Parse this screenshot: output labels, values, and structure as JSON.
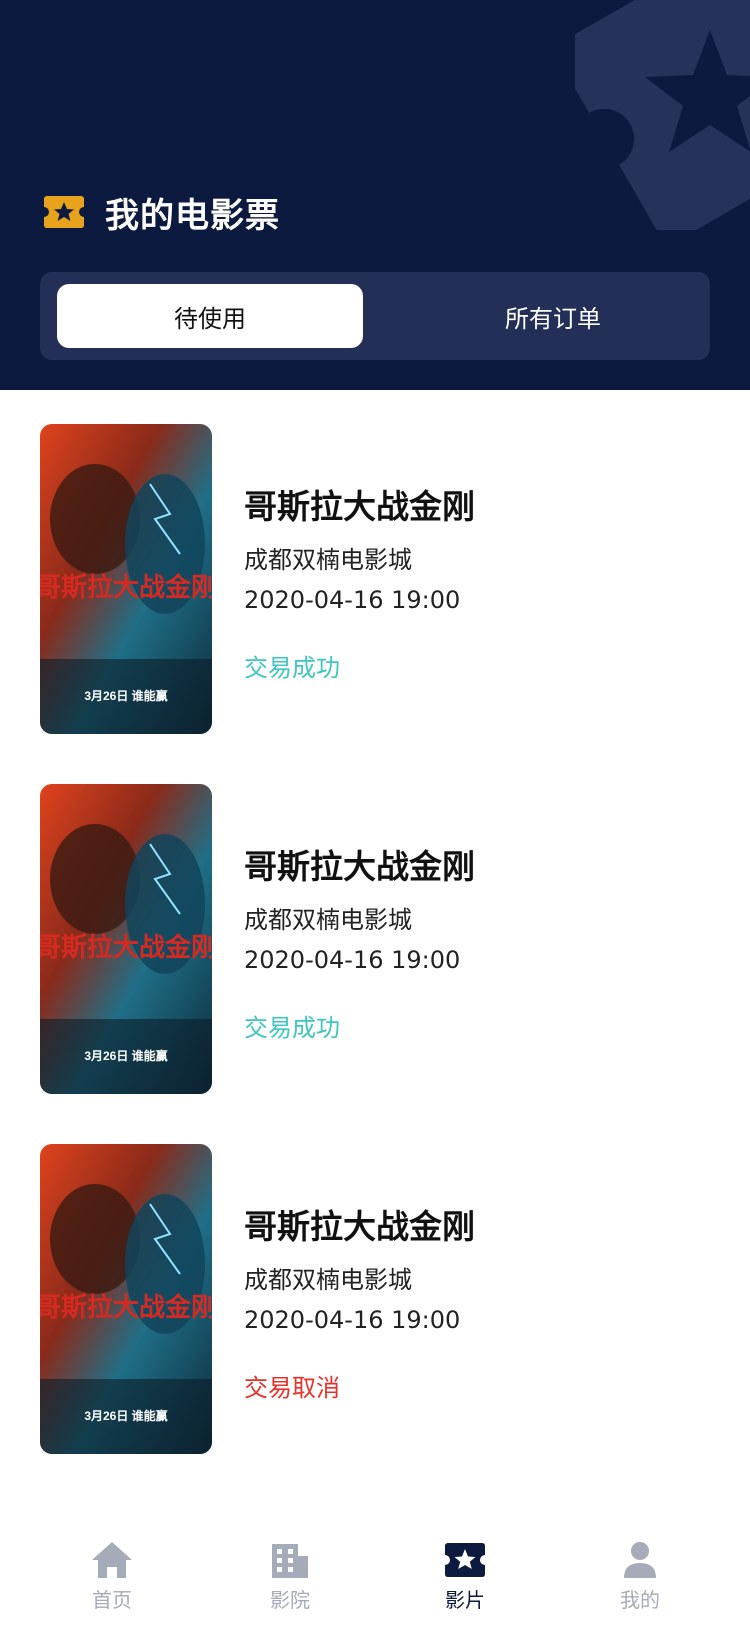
{
  "header": {
    "title": "我的电影票",
    "title_icon": "ticket-star-icon",
    "background_color": "#0d1a3f"
  },
  "tabs": [
    {
      "label": "待使用",
      "active": true
    },
    {
      "label": "所有订单",
      "active": false
    }
  ],
  "orders": [
    {
      "poster": {
        "top_text": "哥斯拉大战金刚",
        "bottom_text": "3月26日 谁能赢"
      },
      "movie_title": "哥斯拉大战金刚",
      "cinema": "成都双楠电影城",
      "datetime": "2020-04-16 19:00",
      "status": "交易成功",
      "status_color": "#3ec6c0"
    },
    {
      "poster": {
        "top_text": "哥斯拉大战金刚",
        "bottom_text": "3月26日 谁能赢"
      },
      "movie_title": "哥斯拉大战金刚",
      "cinema": "成都双楠电影城",
      "datetime": "2020-04-16 19:00",
      "status": "交易成功",
      "status_color": "#3ec6c0"
    },
    {
      "poster": {
        "top_text": "哥斯拉大战金刚",
        "bottom_text": "3月26日 谁能赢"
      },
      "movie_title": "哥斯拉大战金刚",
      "cinema": "成都双楠电影城",
      "datetime": "2020-04-16 19:00",
      "status": "交易取消",
      "status_color": "#e8312a"
    }
  ],
  "tabbar": [
    {
      "label": "首页",
      "icon": "home-icon",
      "active": false
    },
    {
      "label": "影院",
      "icon": "building-icon",
      "active": false
    },
    {
      "label": "影片",
      "icon": "ticket-star-icon",
      "active": true
    },
    {
      "label": "我的",
      "icon": "user-icon",
      "active": false
    }
  ],
  "colors": {
    "accent_gold": "#e7a31e",
    "tab_active_text": "#0d1a3f",
    "tab_inactive_text": "#a6abb9"
  }
}
